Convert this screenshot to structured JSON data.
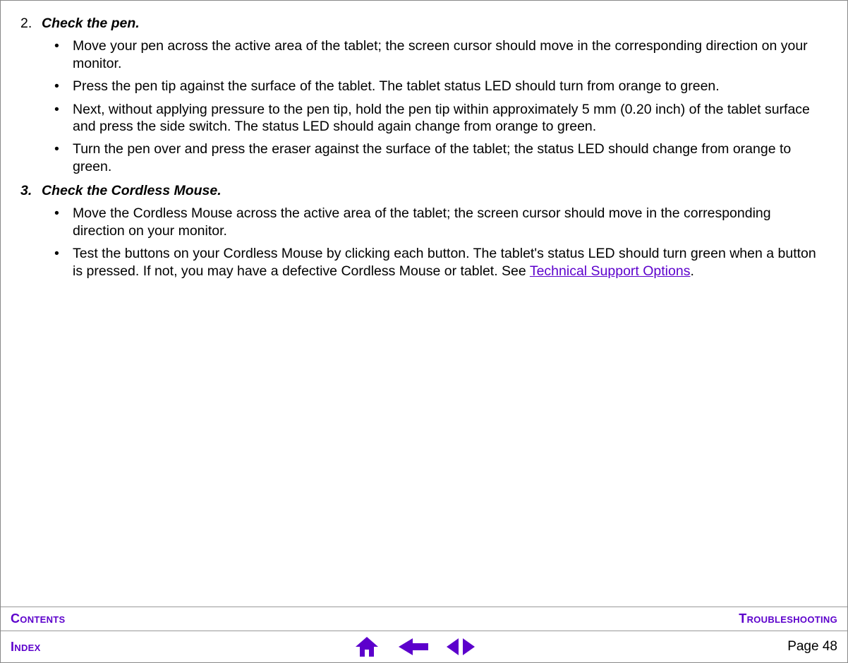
{
  "content": {
    "step2": {
      "number": "2.",
      "title": "Check the pen.",
      "bullets": [
        "Move your pen across the active area of the tablet; the screen cursor should move in the corresponding direction on your monitor.",
        "Press the pen tip against the surface of the tablet.  The tablet status LED should turn from orange to green.",
        "Next, without applying pressure to the pen tip, hold the pen tip within approximately 5 mm (0.20 inch) of the tablet surface and press the side switch.  The status LED should again change from orange to green.",
        "Turn the pen over and press the eraser against the surface of the tablet; the status LED should change from orange to green."
      ]
    },
    "step3": {
      "number": "3.",
      "title": "Check the Cordless Mouse.",
      "bullets": [
        "Move the Cordless Mouse across the active area of the tablet; the screen cursor should move in the corresponding direction on your monitor."
      ],
      "last_bullet_prefix": "Test the buttons on your Cordless Mouse by clicking each button.  The tablet's status LED should turn green when a button is pressed.  If not, you may have a defective Cordless Mouse or tablet.  See ",
      "last_bullet_link": "Technical Support Options",
      "last_bullet_suffix": "."
    }
  },
  "footer": {
    "contents": "Contents",
    "troubleshooting": "Troubleshooting",
    "index": "Index",
    "page_label": "Page  48"
  }
}
